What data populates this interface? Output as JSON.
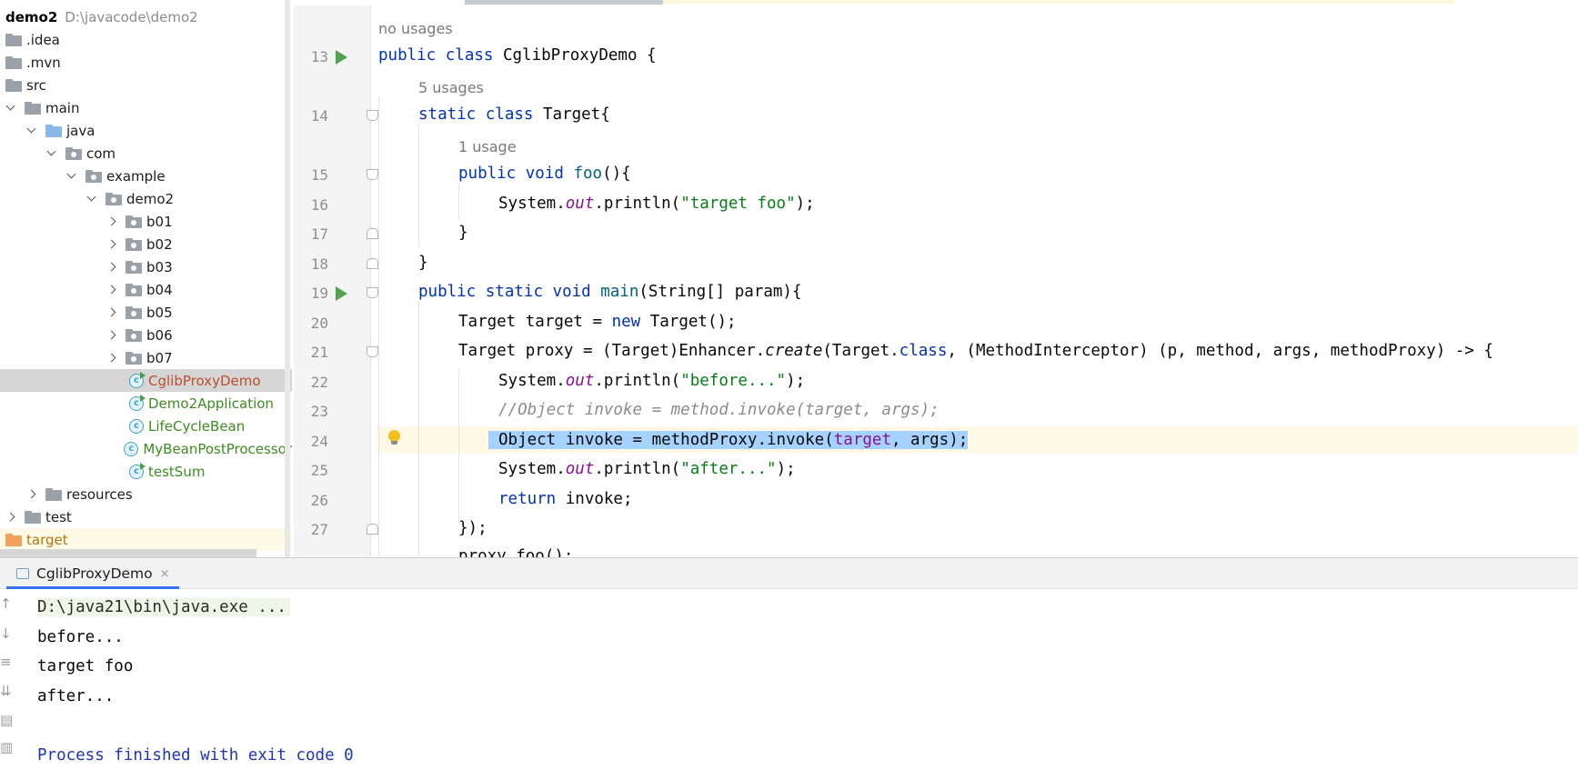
{
  "project_tree": {
    "root": {
      "name": "demo2",
      "path": "D:\\javacode\\demo2"
    },
    "items": [
      {
        "label": "idea",
        "display": ".idea",
        "type": "folder"
      },
      {
        "label": "mvn",
        "display": ".mvn",
        "type": "folder"
      },
      {
        "label": "src",
        "display": "src",
        "type": "folder"
      },
      {
        "label": "main",
        "display": "main",
        "type": "folder"
      },
      {
        "label": "java",
        "display": "java",
        "type": "folder"
      },
      {
        "label": "com",
        "display": "com",
        "type": "package"
      },
      {
        "label": "example",
        "display": "example",
        "type": "package"
      },
      {
        "label": "demo2",
        "display": "demo2",
        "type": "package"
      },
      {
        "label": "b01",
        "display": "b01",
        "type": "package"
      },
      {
        "label": "b02",
        "display": "b02",
        "type": "package"
      },
      {
        "label": "b03",
        "display": "b03",
        "type": "package"
      },
      {
        "label": "b04",
        "display": "b04",
        "type": "package"
      },
      {
        "label": "b05",
        "display": "b05",
        "type": "package"
      },
      {
        "label": "b06",
        "display": "b06",
        "type": "package"
      },
      {
        "label": "b07",
        "display": "b07",
        "type": "package"
      },
      {
        "label": "CglibProxyDemo",
        "display": "CglibProxyDemo",
        "type": "class"
      },
      {
        "label": "Demo2Application",
        "display": "Demo2Application",
        "type": "class"
      },
      {
        "label": "LifeCycleBean",
        "display": "LifeCycleBean",
        "type": "class"
      },
      {
        "label": "MyBeanPostProcessor",
        "display": "MyBeanPostProcessor",
        "type": "class"
      },
      {
        "label": "testSum",
        "display": "testSum",
        "type": "class"
      },
      {
        "label": "resources",
        "display": "resources",
        "type": "folder"
      },
      {
        "label": "test",
        "display": "test",
        "type": "folder"
      },
      {
        "label": "target",
        "display": "target",
        "type": "folder"
      }
    ]
  },
  "editor": {
    "usages": {
      "class": "no usages",
      "target_class": "5 usages",
      "foo": "1 usage"
    },
    "line_numbers": [
      "13",
      "14",
      "15",
      "16",
      "17",
      "18",
      "19",
      "20",
      "21",
      "22",
      "23",
      "24",
      "25",
      "26",
      "27"
    ],
    "code": {
      "l13": [
        "public",
        " ",
        "class",
        " CglibProxyDemo {"
      ],
      "l14": [
        "static",
        " ",
        "class",
        " Target{"
      ],
      "l15": [
        "public",
        " ",
        "void",
        " ",
        "foo",
        "(){"
      ],
      "l16": [
        "System.",
        "out",
        ".println(",
        "\"target foo\"",
        ");"
      ],
      "l17": "}",
      "l18": "}",
      "l19": [
        "public",
        " ",
        "static",
        " ",
        "void",
        " ",
        "main",
        "(String[] param){"
      ],
      "l20": [
        "Target target = ",
        "new",
        " Target();"
      ],
      "l21": [
        "Target proxy = (Target)Enhancer.",
        "create",
        "(Target.",
        "class",
        ", (MethodInterceptor) (p, method, args, methodProxy) -> {"
      ],
      "l22": [
        "System.",
        "out",
        ".println(",
        "\"before...\"",
        ");"
      ],
      "l23": "//Object invoke = method.invoke(target, args);",
      "l24": [
        "Object invoke = methodProxy.invoke(",
        "target",
        ", args);"
      ],
      "l25": [
        "System.",
        "out",
        ".println(",
        "\"after...\"",
        ");"
      ],
      "l26": [
        "return",
        " invoke;"
      ],
      "l27": "});",
      "l28": "proxy.foo();"
    }
  },
  "run_panel": {
    "tab_label": "CglibProxyDemo",
    "close_glyph": "×",
    "console": {
      "command": "D:\\java21\\bin\\java.exe ...",
      "lines": [
        "before...",
        "target foo",
        "after..."
      ],
      "finish": "Process finished with exit code 0"
    }
  }
}
